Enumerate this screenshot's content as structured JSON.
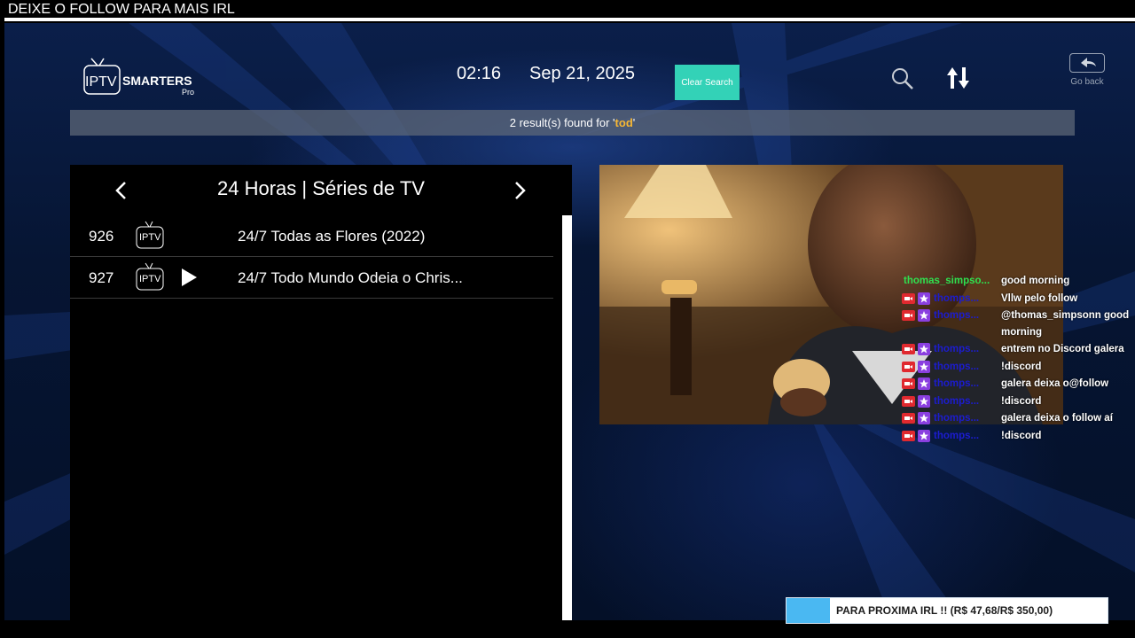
{
  "overlay": {
    "banner": "DEIXE O FOLLOW PARA MAIS IRL"
  },
  "header": {
    "logo": {
      "name": "IPTV SMARTERS Pro",
      "iptv": "IPTV",
      "smarters": "SMARTERS",
      "pro": "Pro"
    },
    "time": "02:16",
    "date": "Sep 21, 2025",
    "clear_search_label": "Clear Search",
    "search_icon": "search-icon",
    "sort_icon": "sort-icon",
    "go_back_label": "Go back",
    "go_back_icon": "back-arrow-icon"
  },
  "search_result": {
    "prefix": "2 result(s) found for '",
    "query": "tod",
    "suffix": "'"
  },
  "list": {
    "category_title": "24 Horas | Séries de TV",
    "prev_icon": "chevron-left-icon",
    "next_icon": "chevron-right-icon",
    "items": [
      {
        "number": "926",
        "title": "24/7 Todas as Flores (2022)",
        "playing": false
      },
      {
        "number": "927",
        "title": "24/7 Todo Mundo Odeia o Chris...",
        "playing": true
      }
    ]
  },
  "chat": {
    "messages": [
      {
        "user": "thomas_simpso...",
        "text": "good morning",
        "user_color": "#2fe04f",
        "badges": false
      },
      {
        "user": "thomps...",
        "text": "Vllw pelo follow",
        "user_color": "#1c1ccf",
        "badges": true
      },
      {
        "user": "thomps...",
        "text": "@thomas_simpsonn good morning",
        "user_color": "#1c1ccf",
        "badges": true
      },
      {
        "user": "thomps...",
        "text": "entrem no Discord galera",
        "user_color": "#1c1ccf",
        "badges": true
      },
      {
        "user": "thomps...",
        "text": "!discord",
        "user_color": "#1c1ccf",
        "badges": true
      },
      {
        "user": "thomps...",
        "text": "galera deixa o@follow",
        "user_color": "#1c1ccf",
        "badges": true
      },
      {
        "user": "thomps...",
        "text": "!discord",
        "user_color": "#1c1ccf",
        "badges": true
      },
      {
        "user": "thomps...",
        "text": "galera deixa o follow aí",
        "user_color": "#1c1ccf",
        "badges": true
      },
      {
        "user": "thomps...",
        "text": "!discord",
        "user_color": "#1c1ccf",
        "badges": true
      }
    ]
  },
  "donation_goal": {
    "label": "PARA PROXIMA IRL !! (R$ 47,68/R$ 350,00)",
    "current": 47.68,
    "target": 350.0,
    "fill_color": "#4ab8f2"
  },
  "colors": {
    "accent": "#33d2b7",
    "query_highlight": "#f7b733",
    "background": "#061533"
  }
}
